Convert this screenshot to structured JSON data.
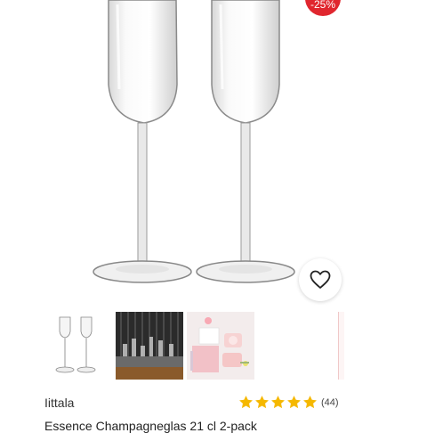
{
  "product": {
    "discount_badge": "-25%",
    "brand": "Iittala",
    "title": "Essence Champagneglas 21 cl 2-pack",
    "rating": {
      "stars": 5,
      "count_label": "(44)"
    }
  },
  "icons": {
    "wishlist": "heart-icon",
    "star": "star-icon"
  },
  "colors": {
    "badge": "#e0262e",
    "star": "#f5b800"
  }
}
